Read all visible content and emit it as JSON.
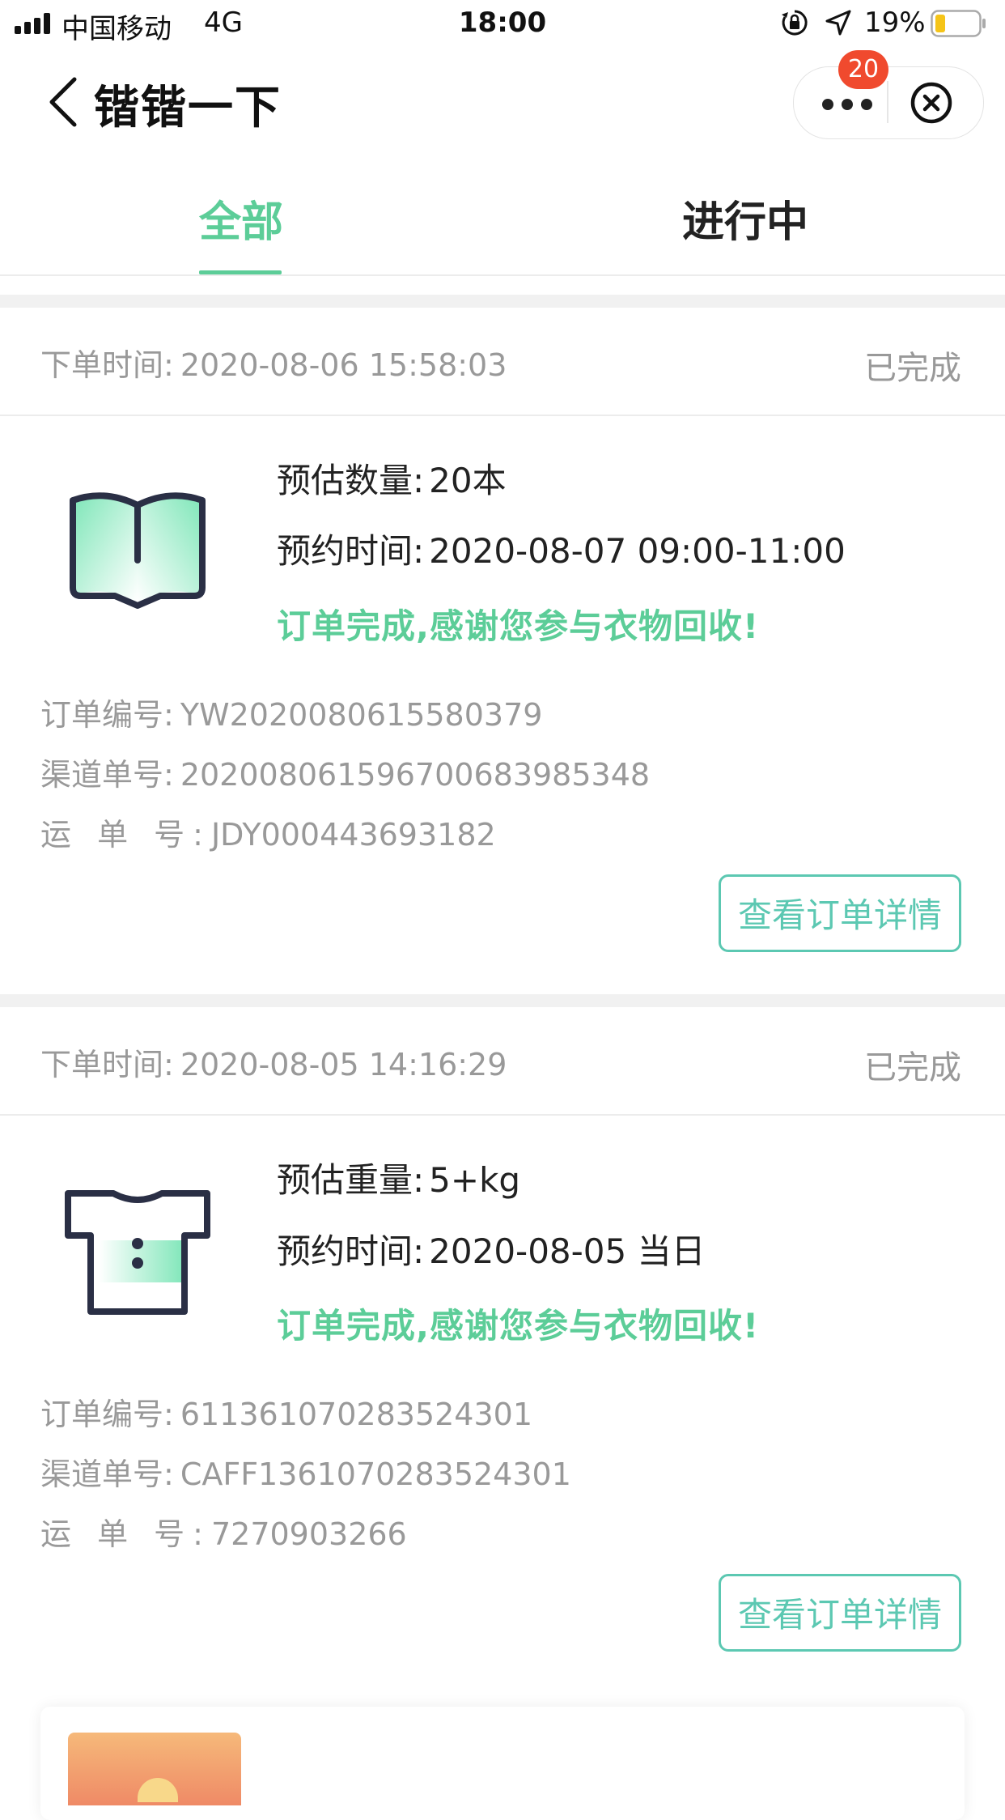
{
  "status_bar": {
    "carrier": "中国移动",
    "network": "4G",
    "time": "18:00",
    "battery": "19%"
  },
  "nav": {
    "title": "锴锴一下",
    "badge": "20"
  },
  "tabs": [
    {
      "label": "全部",
      "active": true
    },
    {
      "label": "进行中",
      "active": false
    }
  ],
  "orders": [
    {
      "time_label": "下单时间:",
      "time_value": "2020-08-06 15:58:03",
      "status": "已完成",
      "icon": "book-icon",
      "line1_label": "预估数量:",
      "line1_value": "20本",
      "line2_label": "预约时间:",
      "line2_value": "2020-08-07 09:00-11:00",
      "message": "订单完成,感谢您参与衣物回收!",
      "order_no_label": "订单编号:",
      "order_no": "YW2020080615580379",
      "channel_no_label": "渠道单号:",
      "channel_no": "20200806159670068398534​8",
      "waybill_label": "运 单 号:",
      "waybill_no": "JDY000443693182",
      "button": "查看订单详情"
    },
    {
      "time_label": "下单时间:",
      "time_value": "2020-08-05 14:16:29",
      "status": "已完成",
      "icon": "tshirt-icon",
      "line1_label": "预估重量:",
      "line1_value": "5+kg",
      "line2_label": "预约时间:",
      "line2_value": "2020-08-05 当日",
      "message": "订单完成,感谢您参与衣物回收!",
      "order_no_label": "订单编号:",
      "order_no": "611361070283524301",
      "channel_no_label": "渠道单号:",
      "channel_no": "CAFF1361070283524301",
      "waybill_label": "运 单 号:",
      "waybill_no": "7270903266",
      "button": "查看订单详情"
    }
  ],
  "colors": {
    "accent": "#5ccd98",
    "button_border": "#5cc8b2",
    "badge": "#f04a2e",
    "muted_text": "#999999"
  }
}
